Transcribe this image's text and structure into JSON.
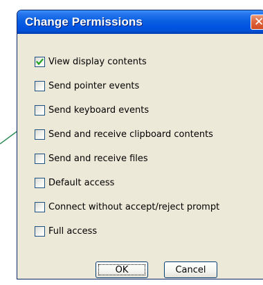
{
  "dialog": {
    "title": "Change Permissions",
    "close_icon": "close-icon",
    "options": [
      {
        "label": "View display contents",
        "checked": true
      },
      {
        "label": "Send pointer events",
        "checked": false
      },
      {
        "label": "Send keyboard events",
        "checked": false
      },
      {
        "label": "Send and receive clipboard contents",
        "checked": false
      },
      {
        "label": "Send and receive files",
        "checked": false
      },
      {
        "label": "Default access",
        "checked": false
      },
      {
        "label": "Connect without accept/reject prompt",
        "checked": false
      },
      {
        "label": "Full access",
        "checked": false
      }
    ],
    "ok_label": "OK",
    "cancel_label": "Cancel"
  },
  "colors": {
    "titlebar": "#0054e3",
    "dialog_background": "#ece9d8",
    "close_button": "#e0663f",
    "connector_line": "#2e8b57",
    "checkmark": "#21a121"
  }
}
